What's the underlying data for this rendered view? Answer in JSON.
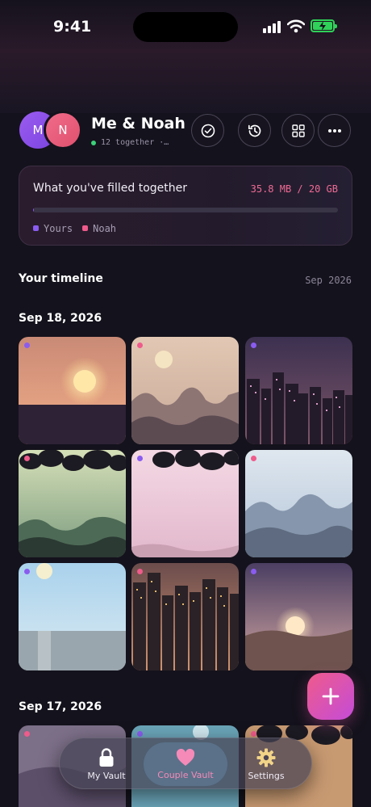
{
  "status_bar": {
    "time": "9:41"
  },
  "header": {
    "avatar_me": "M",
    "avatar_partner": "N",
    "title": "Me & Noah",
    "subtitle": "12 together ·…"
  },
  "storage": {
    "label": "What you've filled together",
    "usage": "35.8 MB / 20 GB",
    "fill_fraction": 0.002,
    "legend": [
      {
        "label": "Yours",
        "color": "#8a5cf0"
      },
      {
        "label": "Noah",
        "color": "#ef5b8b"
      }
    ]
  },
  "timeline": {
    "title": "Your timeline",
    "month": "Sep 2026",
    "groups": [
      {
        "date": "Sep 18, 2026"
      },
      {
        "date": "Sep 17, 2026"
      }
    ]
  },
  "colors": {
    "yours": "#8a5cf0",
    "noah": "#ef5b8b",
    "accent": "#ef5b8b"
  },
  "nav": {
    "items": [
      {
        "label": "My Vault",
        "icon": "lock-icon"
      },
      {
        "label": "Couple Vault",
        "icon": "heart-icon"
      },
      {
        "label": "Settings",
        "icon": "gear-icon"
      }
    ]
  }
}
